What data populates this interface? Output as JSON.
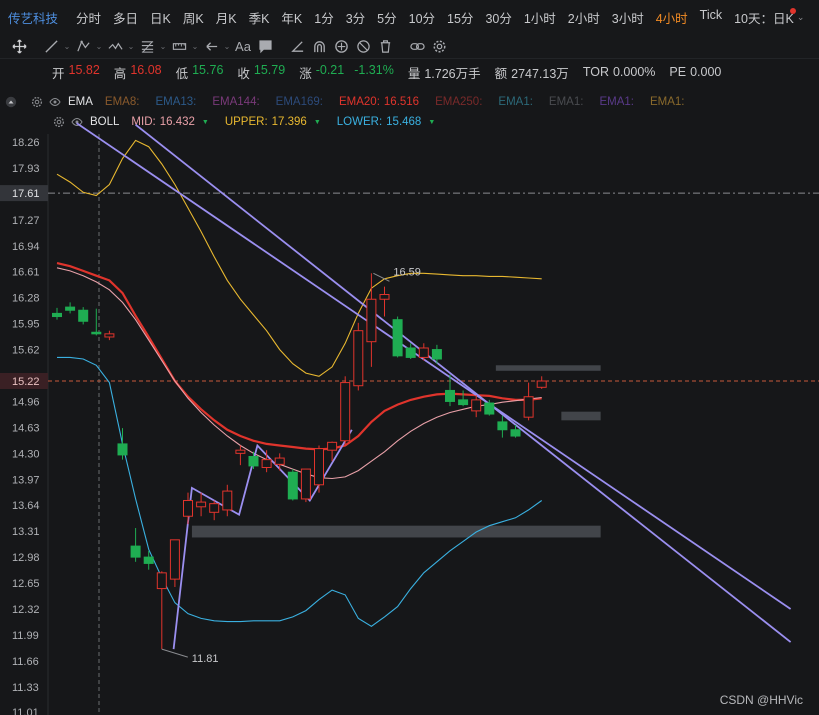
{
  "header": {
    "stock_name": "传艺科技",
    "periods": [
      "分时",
      "多日",
      "日K",
      "周K",
      "月K",
      "季K",
      "年K",
      "1分",
      "3分",
      "5分",
      "10分",
      "15分",
      "30分",
      "1小时",
      "2小时",
      "3小时",
      "4小时",
      "Tick"
    ],
    "active_period": "4小时",
    "range_label": "10天：日K"
  },
  "toolbar": {
    "tools": [
      "crosshair-icon",
      "line-tool-icon",
      "pen-tool-icon",
      "zigzag-tool-icon",
      "fib-tool-icon",
      "ruler-tool-icon",
      "arrow-tool-icon",
      "text-tool-icon",
      "comment-tool-icon",
      "angle-tool-icon",
      "magnet-icon",
      "sync-icon",
      "hide-icon",
      "delete-icon",
      "link-icon",
      "settings-icon"
    ],
    "text_tool_label": "Aa"
  },
  "ohlc": {
    "open_label": "开",
    "open": "15.82",
    "high_label": "高",
    "high": "16.08",
    "low_label": "低",
    "low": "15.76",
    "close_label": "收",
    "close": "15.79",
    "change_label": "涨",
    "change": "-0.21",
    "change_pct": "-1.31%",
    "volume_label": "量",
    "volume": "1.726万手",
    "amount_label": "额",
    "amount": "2747.13万",
    "tor_label": "TOR",
    "tor": "0.000%",
    "pe_label": "PE",
    "pe": "0.000"
  },
  "indicators": {
    "ema": {
      "name": "EMA",
      "items": [
        {
          "label": "EMA8:",
          "value": "",
          "color": "#8a5a2c"
        },
        {
          "label": "EMA13:",
          "value": "",
          "color": "#2c5a8a"
        },
        {
          "label": "EMA144:",
          "value": "",
          "color": "#7a3a7a"
        },
        {
          "label": "EMA169:",
          "value": "",
          "color": "#2c4a7a"
        },
        {
          "label": "EMA20:",
          "value": "16.516",
          "color": "#e0342c"
        },
        {
          "label": "EMA250:",
          "value": "",
          "color": "#7a2a2a"
        },
        {
          "label": "EMA1:",
          "value": "",
          "color": "#2c6a7a"
        },
        {
          "label": "EMA1:",
          "value": "",
          "color": "#4a4c50"
        },
        {
          "label": "EMA1:",
          "value": "",
          "color": "#5a3a8a"
        },
        {
          "label": "EMA1:",
          "value": "",
          "color": "#8a6a2c"
        }
      ]
    },
    "boll": {
      "name": "BOLL",
      "items": [
        {
          "label": "MID:",
          "value": "16.432",
          "color": "#e8a0a8"
        },
        {
          "label": "UPPER:",
          "value": "17.396",
          "color": "#e8b830"
        },
        {
          "label": "LOWER:",
          "value": "15.468",
          "color": "#3ab0e0"
        }
      ]
    }
  },
  "chart_data": {
    "type": "candlestick",
    "y_ticks": [
      18.26,
      17.93,
      17.61,
      17.27,
      16.94,
      16.61,
      16.28,
      15.95,
      15.62,
      15.22,
      14.96,
      14.63,
      14.3,
      13.97,
      13.64,
      13.31,
      12.98,
      12.65,
      12.32,
      11.99,
      11.66,
      11.33,
      11.01
    ],
    "y_range": [
      11.01,
      18.26
    ],
    "highlight_levels": [
      {
        "value": 17.61,
        "label": "17.61",
        "style": "gray-dashed"
      },
      {
        "value": 15.22,
        "label": "15.22",
        "style": "red-dashed"
      }
    ],
    "annotations": [
      {
        "text": "16.59",
        "value": 16.59
      },
      {
        "text": "11.81",
        "value": 11.81
      }
    ],
    "candles": [
      {
        "o": 16.08,
        "h": 16.15,
        "l": 16.0,
        "c": 16.04
      },
      {
        "o": 16.16,
        "h": 16.22,
        "l": 16.08,
        "c": 16.12
      },
      {
        "o": 16.12,
        "h": 16.16,
        "l": 15.94,
        "c": 15.98
      },
      {
        "o": 15.84,
        "h": 16.14,
        "l": 15.8,
        "c": 15.82
      },
      {
        "o": 15.78,
        "h": 15.86,
        "l": 15.74,
        "c": 15.82
      },
      {
        "o": 14.42,
        "h": 14.62,
        "l": 14.22,
        "c": 14.28
      },
      {
        "o": 13.12,
        "h": 13.35,
        "l": 12.92,
        "c": 12.98
      },
      {
        "o": 12.98,
        "h": 13.06,
        "l": 12.82,
        "c": 12.9
      },
      {
        "o": 12.58,
        "h": 12.8,
        "l": 11.81,
        "c": 12.78
      },
      {
        "o": 12.7,
        "h": 13.2,
        "l": 12.6,
        "c": 13.2
      },
      {
        "o": 13.5,
        "h": 13.8,
        "l": 13.4,
        "c": 13.7
      },
      {
        "o": 13.62,
        "h": 13.8,
        "l": 13.5,
        "c": 13.68
      },
      {
        "o": 13.55,
        "h": 13.7,
        "l": 13.45,
        "c": 13.66
      },
      {
        "o": 13.58,
        "h": 13.9,
        "l": 13.5,
        "c": 13.82
      },
      {
        "o": 14.3,
        "h": 14.4,
        "l": 14.15,
        "c": 14.34
      },
      {
        "o": 14.26,
        "h": 14.32,
        "l": 14.1,
        "c": 14.14
      },
      {
        "o": 14.12,
        "h": 14.34,
        "l": 14.06,
        "c": 14.22
      },
      {
        "o": 14.16,
        "h": 14.3,
        "l": 14.08,
        "c": 14.24
      },
      {
        "o": 14.06,
        "h": 14.1,
        "l": 13.7,
        "c": 13.72
      },
      {
        "o": 13.72,
        "h": 14.1,
        "l": 13.68,
        "c": 14.1
      },
      {
        "o": 13.9,
        "h": 14.4,
        "l": 13.8,
        "c": 14.36
      },
      {
        "o": 14.34,
        "h": 14.45,
        "l": 14.2,
        "c": 14.44
      },
      {
        "o": 14.46,
        "h": 15.28,
        "l": 14.4,
        "c": 15.2
      },
      {
        "o": 15.16,
        "h": 15.96,
        "l": 15.1,
        "c": 15.86
      },
      {
        "o": 15.72,
        "h": 16.59,
        "l": 15.4,
        "c": 16.26
      },
      {
        "o": 16.26,
        "h": 16.42,
        "l": 16.04,
        "c": 16.32
      },
      {
        "o": 16.0,
        "h": 16.04,
        "l": 15.52,
        "c": 15.54
      },
      {
        "o": 15.64,
        "h": 15.7,
        "l": 15.5,
        "c": 15.52
      },
      {
        "o": 15.52,
        "h": 15.7,
        "l": 15.48,
        "c": 15.64
      },
      {
        "o": 15.62,
        "h": 15.68,
        "l": 15.44,
        "c": 15.5
      },
      {
        "o": 15.1,
        "h": 15.3,
        "l": 14.9,
        "c": 14.96
      },
      {
        "o": 14.98,
        "h": 15.1,
        "l": 14.9,
        "c": 14.92
      },
      {
        "o": 14.84,
        "h": 15.04,
        "l": 14.76,
        "c": 14.98
      },
      {
        "o": 14.94,
        "h": 14.98,
        "l": 14.78,
        "c": 14.8
      },
      {
        "o": 14.7,
        "h": 14.78,
        "l": 14.5,
        "c": 14.6
      },
      {
        "o": 14.6,
        "h": 14.66,
        "l": 14.5,
        "c": 14.52
      },
      {
        "o": 14.76,
        "h": 15.2,
        "l": 14.72,
        "c": 15.02
      },
      {
        "o": 15.14,
        "h": 15.28,
        "l": 15.12,
        "c": 15.22
      }
    ],
    "series": [
      {
        "name": "EMA20",
        "color": "#e0342c",
        "values": [
          16.72,
          16.68,
          16.62,
          16.56,
          16.5,
          16.34,
          16.05,
          15.78,
          15.5,
          15.22,
          15.02,
          14.86,
          14.72,
          14.6,
          14.52,
          14.46,
          14.42,
          14.4,
          14.38,
          14.36,
          14.35,
          14.36,
          14.4,
          14.52,
          14.7,
          14.84,
          14.92,
          14.98,
          15.02,
          15.05,
          15.06,
          15.05,
          15.04,
          15.03,
          15.0,
          14.98,
          14.98,
          15.0
        ]
      },
      {
        "name": "BOLL MID",
        "color": "#e8a0a8",
        "values": [
          16.66,
          16.62,
          16.56,
          16.48,
          16.38,
          16.22,
          16.0,
          15.74,
          15.48,
          15.22,
          15.0,
          14.82,
          14.66,
          14.52,
          14.4,
          14.3,
          14.22,
          14.16,
          14.1,
          14.04,
          13.99,
          13.98,
          14.0,
          14.08,
          14.2,
          14.32,
          14.46,
          14.58,
          14.68,
          14.76,
          14.82,
          14.86,
          14.9,
          14.92,
          14.95,
          14.97,
          14.99,
          15.01
        ]
      },
      {
        "name": "BOLL UPPER",
        "color": "#e8b830",
        "values": [
          17.85,
          17.75,
          17.62,
          17.58,
          17.72,
          18.05,
          18.28,
          18.2,
          17.98,
          17.72,
          17.42,
          17.12,
          16.8,
          16.5,
          16.26,
          16.06,
          15.86,
          15.62,
          15.44,
          15.32,
          15.28,
          15.4,
          15.7,
          16.08,
          16.4,
          16.52,
          16.56,
          16.59,
          16.59,
          16.58,
          16.57,
          16.56,
          16.56,
          16.55,
          16.55,
          16.54,
          16.53,
          16.52
        ]
      },
      {
        "name": "BOLL LOWER",
        "color": "#3ab0e0",
        "values": [
          15.52,
          15.52,
          15.5,
          15.42,
          15.2,
          14.42,
          13.72,
          13.08,
          12.72,
          12.4,
          12.26,
          12.2,
          12.17,
          12.16,
          12.16,
          12.17,
          12.17,
          12.17,
          12.22,
          12.3,
          12.44,
          12.56,
          12.5,
          12.2,
          12.1,
          12.22,
          12.35,
          12.58,
          12.78,
          12.92,
          13.06,
          13.18,
          13.3,
          13.38,
          13.43,
          13.48,
          13.58,
          13.7
        ]
      }
    ]
  },
  "watermark": "CSDN @HHVic"
}
